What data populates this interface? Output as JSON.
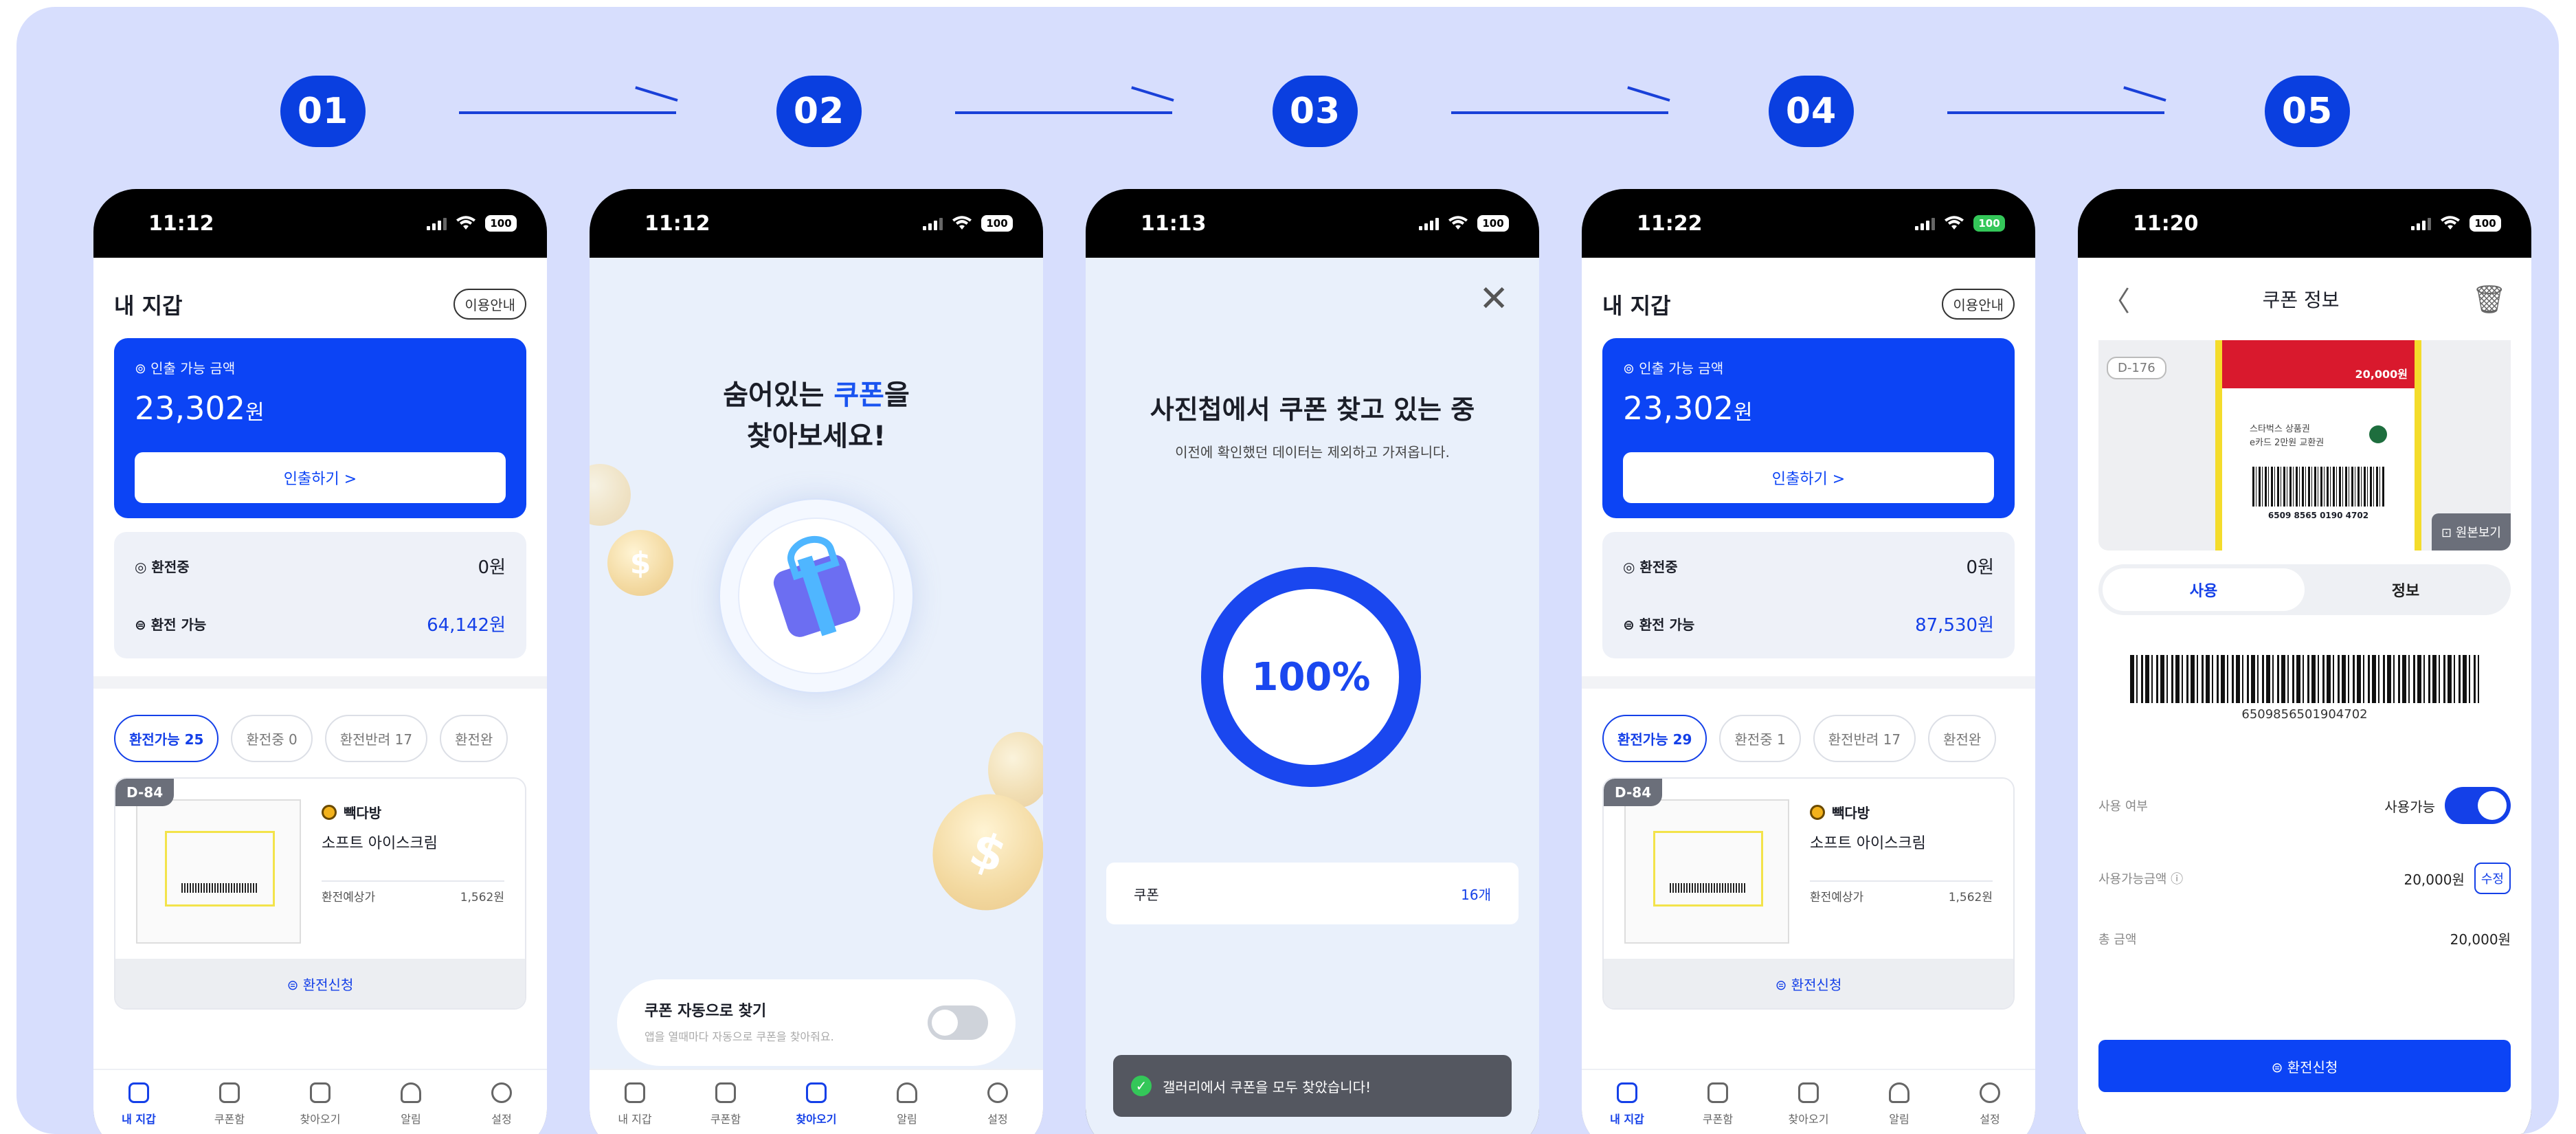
{
  "steps": [
    "01",
    "02",
    "03",
    "04",
    "05"
  ],
  "status": {
    "p1": {
      "time": "11:12",
      "battery": "100"
    },
    "p2": {
      "time": "11:12",
      "battery": "100"
    },
    "p3": {
      "time": "11:13",
      "battery": "100"
    },
    "p4": {
      "time": "11:22",
      "battery": "100"
    },
    "p5": {
      "time": "11:20",
      "battery": "100"
    }
  },
  "wallet": {
    "title": "내 지갑",
    "guide_label": "이용안내",
    "withdraw_label": "⊚ 인출 가능 금액",
    "amount": "23,302",
    "amount_unit": "원",
    "withdraw_button": "인출하기 >",
    "exchanging_label": "환전중",
    "exchangeable_label": "환전 가능",
    "exchanging_value": "0원"
  },
  "screen1": {
    "exchangeable_value": "64,142원",
    "chips": [
      "환전가능 25",
      "환전중 0",
      "환전반려 17",
      "환전완"
    ]
  },
  "screen4": {
    "exchangeable_value": "87,530원",
    "chips": [
      "환전가능 29",
      "환전중 1",
      "환전반려 17",
      "환전완"
    ]
  },
  "coupon_card": {
    "dday": "D-84",
    "store": "빽다방",
    "product": "소프트 아이스크림",
    "est_label": "환전예상가",
    "est_value": "1,562원",
    "apply_label": "⊜ 환전신청"
  },
  "tabbar": [
    "내 지갑",
    "쿠폰함",
    "찾아오기",
    "알림",
    "설정"
  ],
  "screen2": {
    "headline_pre": "숨어있는 ",
    "headline_accent": "쿠폰",
    "headline_post": "을",
    "headline_line2": "찾아보세요!",
    "auto_title": "쿠폰 자동으로 찾기",
    "auto_desc": "앱을 열때마다 자동으로 쿠폰을 찾아줘요."
  },
  "screen3": {
    "close": "✕",
    "headline": "사진첩에서 쿠폰 찾고 있는 중",
    "subtitle": "이전에 확인했던 데이터는 제외하고 가져옵니다.",
    "progress": "100%",
    "progress_value": 1.0,
    "count_label": "쿠폰",
    "count_value": "16개",
    "toast": "갤러리에서 쿠폰을 모두 찾았습니다!"
  },
  "screen5": {
    "back": "〈",
    "title": "쿠폰 정보",
    "trash": "🗑",
    "dday": "D-176",
    "ticket_price": "20,000원",
    "ticket_name_1": "스타벅스 상품권",
    "ticket_name_2": "e카드 2만원 교환권",
    "ticket_barcode": "6509 8565 0190 4702",
    "original_view": "⊡ 원본보기",
    "tab_use": "사용",
    "tab_info": "정보",
    "barcode_number": "6509856501904702",
    "use_label": "사용 여부",
    "use_value": "사용가능",
    "amount_label": "사용가능금액 ⓘ",
    "amount_value": "20,000원",
    "edit_label": "수정",
    "total_label": "총 금액",
    "total_value": "20,000원",
    "apply_label": "⊜ 환전신청"
  }
}
